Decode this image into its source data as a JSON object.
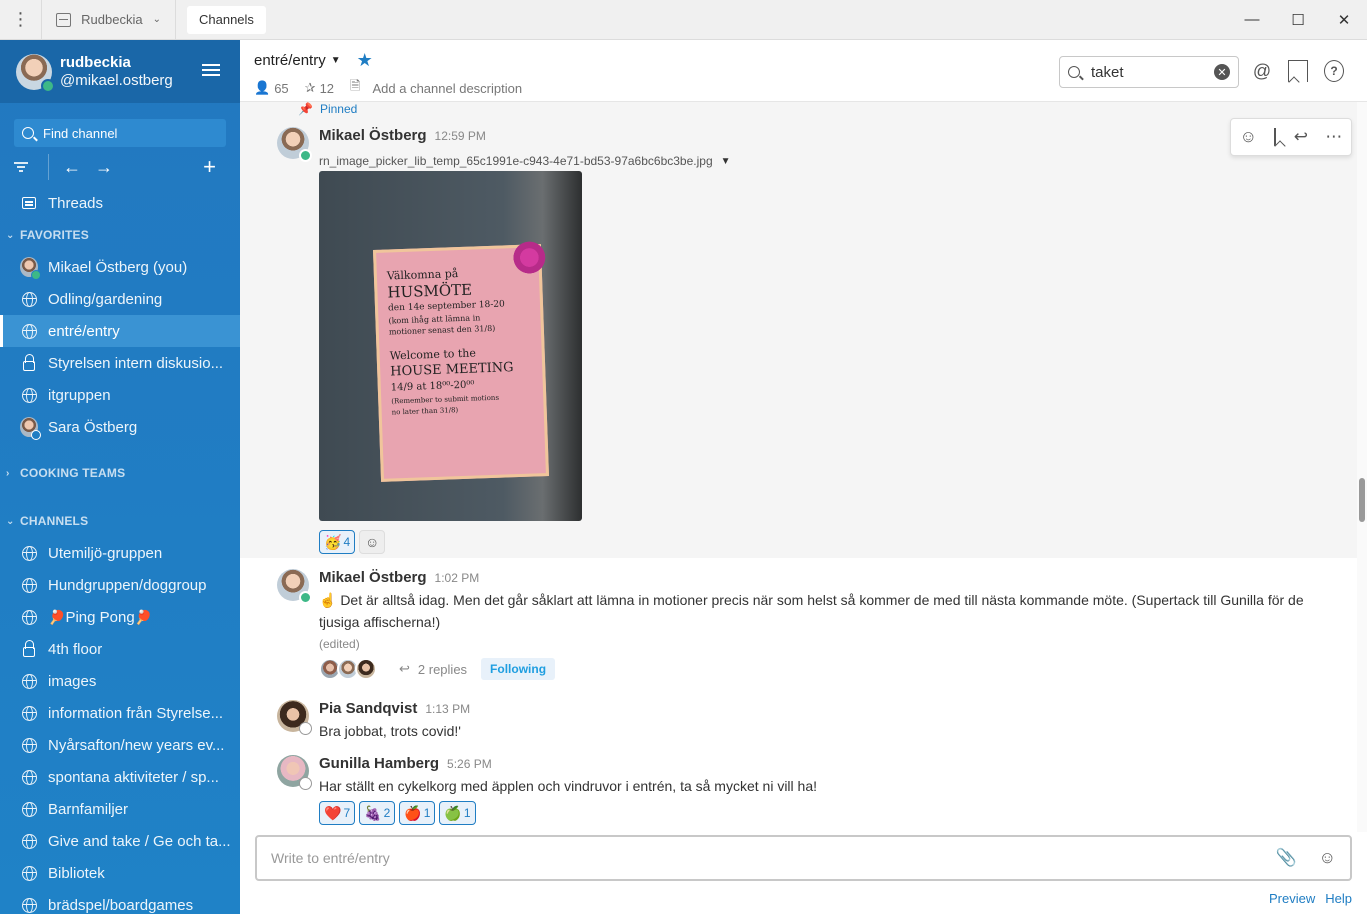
{
  "titlebar": {
    "server": "Rudbeckia",
    "tab": "Channels"
  },
  "sidebar": {
    "team": "rudbeckia",
    "handle": "@mikael.ostberg",
    "find_placeholder": "Find channel",
    "threads": "Threads",
    "favorites_label": "FAVORITES",
    "favorites": [
      {
        "label": "Mikael Östberg (you)",
        "icon": "avatar"
      },
      {
        "label": "Odling/gardening",
        "icon": "globe"
      },
      {
        "label": "entré/entry",
        "icon": "globe",
        "active": true
      },
      {
        "label": "Styrelsen intern diskusio...",
        "icon": "lock"
      },
      {
        "label": "itgruppen",
        "icon": "globe"
      },
      {
        "label": "Sara Östberg",
        "icon": "avatar"
      }
    ],
    "cooking_label": "COOKING TEAMS",
    "channels_label": "CHANNELS",
    "channels": [
      {
        "label": "Utemiljö-gruppen",
        "icon": "globe"
      },
      {
        "label": "Hundgruppen/doggroup",
        "icon": "globe"
      },
      {
        "label": "Ping Pong",
        "icon": "globe"
      },
      {
        "label": "4th floor",
        "icon": "lock"
      },
      {
        "label": "images",
        "icon": "globe"
      },
      {
        "label": "information från Styrelse...",
        "icon": "globe"
      },
      {
        "label": "Nyårsafton/new years ev...",
        "icon": "globe"
      },
      {
        "label": "spontana aktiviteter / sp...",
        "icon": "globe"
      },
      {
        "label": "Barnfamiljer",
        "icon": "globe"
      },
      {
        "label": "Give and take / Ge och ta...",
        "icon": "globe"
      },
      {
        "label": "Bibliotek",
        "icon": "globe"
      },
      {
        "label": "brädspel/boardgames",
        "icon": "globe"
      }
    ]
  },
  "channel": {
    "name": "entré/entry",
    "members": "65",
    "pinned_count": "12",
    "description_placeholder": "Add a channel description",
    "search_value": "taket"
  },
  "posts": {
    "pinned_label": "Pinned",
    "p1": {
      "author": "Mikael Östberg",
      "time": "12:59 PM",
      "filename": "rn_image_picker_lib_temp_65c1991e-c943-4e71-bd53-97a6bc6bc3be.jpg",
      "reaction_count": "4",
      "poster_lines": [
        "Välkomna på",
        "HUSMÖTE",
        "den 14e september 18-20",
        "(kom ihåg att lämna in",
        "motioner senast den 31/8)",
        "Welcome to the",
        "HOUSE MEETING",
        "14/9 at 18⁰⁰-20⁰⁰",
        "(Remember to submit motions",
        "no later than 31/8)"
      ]
    },
    "p2": {
      "author": "Mikael Östberg",
      "time": "1:02 PM",
      "text": "☝️ Det är alltså idag. Men det går såklart att lämna in motioner precis när som helst så kommer de med till nästa kommande möte. (Supertack till Gunilla för de tjusiga affischerna!)",
      "edited": "(edited)",
      "replies": "2 replies",
      "following": "Following"
    },
    "p3": {
      "author": "Pia Sandqvist",
      "time": "1:13 PM",
      "text": "Bra jobbat, trots covid!'"
    },
    "p4": {
      "author": "Gunilla Hamberg",
      "time": "5:26 PM",
      "text": "Har ställt en cykelkorg med äpplen och vindruvor i entrén, ta så mycket ni vill ha!",
      "reactions": [
        {
          "emoji": "❤️",
          "count": "7"
        },
        {
          "emoji": "🍇",
          "count": "2"
        },
        {
          "emoji": "🍎",
          "count": "1"
        },
        {
          "emoji": "🍏",
          "count": "1"
        }
      ]
    }
  },
  "composer": {
    "placeholder": "Write to entré/entry",
    "preview": "Preview",
    "help": "Help"
  }
}
